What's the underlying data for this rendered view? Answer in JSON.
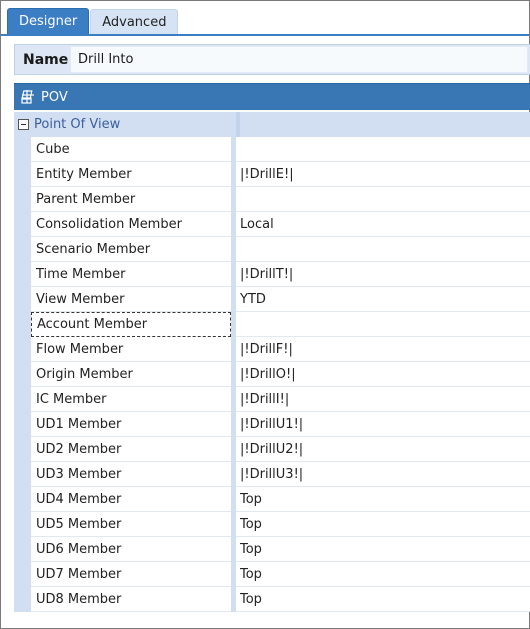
{
  "tabs": [
    {
      "label": "Designer",
      "active": true
    },
    {
      "label": "Advanced",
      "active": false
    }
  ],
  "name_field": {
    "label": "Name",
    "value": "Drill Into"
  },
  "section": {
    "title": "POV",
    "icon": "pov-grid-icon"
  },
  "group": {
    "label": "Point Of View",
    "expanded": true
  },
  "properties": [
    {
      "name": "Cube",
      "value": ""
    },
    {
      "name": "Entity Member",
      "value": "|!DrillE!|"
    },
    {
      "name": "Parent Member",
      "value": ""
    },
    {
      "name": "Consolidation Member",
      "value": "Local"
    },
    {
      "name": "Scenario Member",
      "value": ""
    },
    {
      "name": "Time Member",
      "value": "|!DrillT!|"
    },
    {
      "name": "View Member",
      "value": "YTD"
    },
    {
      "name": "Account Member",
      "value": ""
    },
    {
      "name": "Flow Member",
      "value": "|!DrillF!|"
    },
    {
      "name": "Origin Member",
      "value": "|!DrillO!|"
    },
    {
      "name": "IC Member",
      "value": "|!DrillI!|"
    },
    {
      "name": "UD1 Member",
      "value": "|!DrillU1!|"
    },
    {
      "name": "UD2 Member",
      "value": "|!DrillU2!|"
    },
    {
      "name": "UD3 Member",
      "value": "|!DrillU3!|"
    },
    {
      "name": "UD4 Member",
      "value": "Top"
    },
    {
      "name": "UD5 Member",
      "value": "Top"
    },
    {
      "name": "UD6 Member",
      "value": "Top"
    },
    {
      "name": "UD7 Member",
      "value": "Top"
    },
    {
      "name": "UD8 Member",
      "value": "Top"
    }
  ],
  "colors": {
    "accent": "#3b7ec4",
    "section_bg": "#3876b4",
    "group_bg": "#d2def2",
    "name_row_bg": "#dce6f4"
  }
}
